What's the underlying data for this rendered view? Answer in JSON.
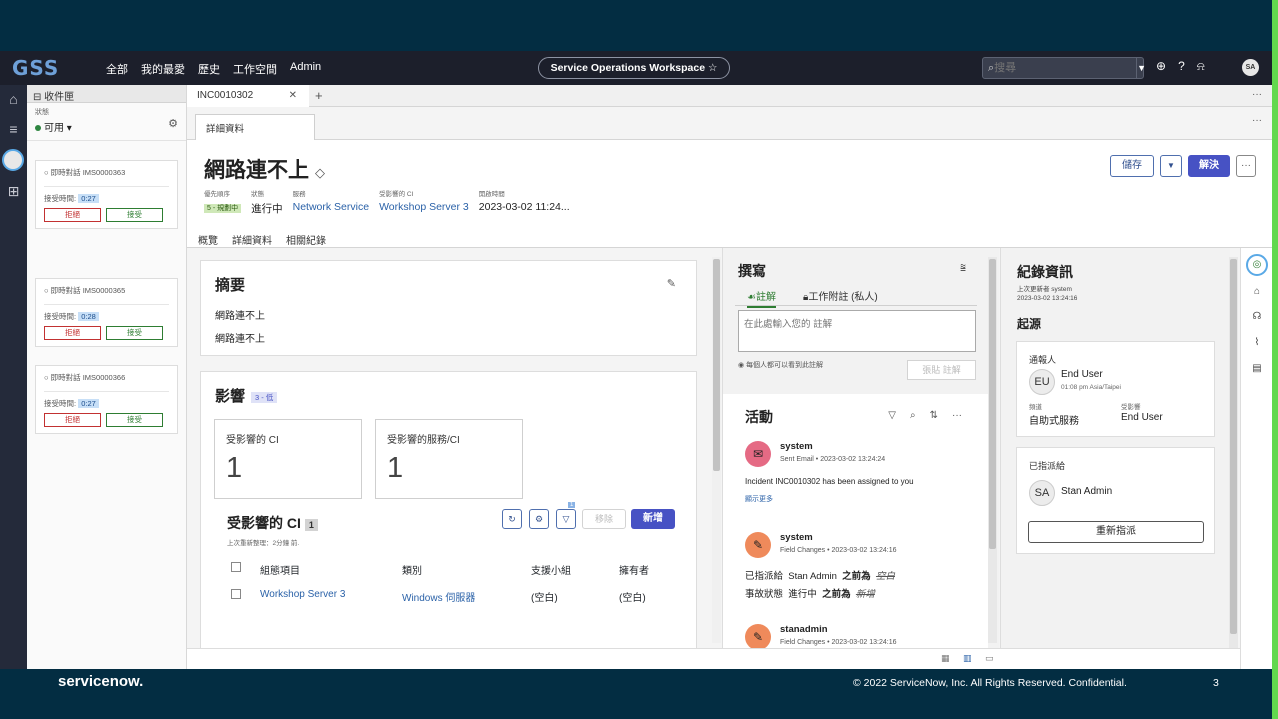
{
  "nav": {
    "logo": "GSS",
    "menu": [
      "全部",
      "我的最愛",
      "歷史",
      "工作空間",
      "Admin"
    ],
    "workspace": "Service Operations Workspace ☆",
    "search_placeholder": "搜尋",
    "avatar": "SA"
  },
  "inbox": {
    "title": "收件匣",
    "status_label": "狀態",
    "status_value": "可用 ▾",
    "cards": [
      {
        "id": "即時對話 IMS0000363",
        "time_label": "接受時間:",
        "time": "0:27",
        "decline": "拒絕",
        "accept": "接受"
      },
      {
        "id": "即時對話 IMS0000365",
        "time_label": "接受時間:",
        "time": "0:28",
        "decline": "拒絕",
        "accept": "接受"
      },
      {
        "id": "即時對話 IMS0000366",
        "time_label": "接受時間:",
        "time": "0:27",
        "decline": "拒絕",
        "accept": "接受"
      }
    ]
  },
  "tabs": {
    "record_tab": "INC0010302",
    "subtab": "詳細資料"
  },
  "record": {
    "title": "網路連不上",
    "buttons": {
      "save": "儲存",
      "resolve": "解決"
    },
    "meta": {
      "priority_label": "優先順序",
      "priority": "5 - 規劃中",
      "state_label": "狀態",
      "state": "進行中",
      "service_label": "服務",
      "service": "Network Service",
      "ci_label": "受影響的 CI",
      "ci": "Workshop Server 3",
      "opened_label": "開啟時間",
      "opened": "2023-03-02 11:24..."
    },
    "tabs": [
      "概覽",
      "詳細資料",
      "相關紀錄"
    ]
  },
  "summary": {
    "title": "摘要",
    "line1": "網路連不上",
    "line2": "網路連不上"
  },
  "impact": {
    "title": "影響",
    "badge": "3 - 低",
    "tile1_label": "受影響的 CI",
    "tile1_value": "1",
    "tile2_label": "受影響的服務/CI",
    "tile2_value": "1",
    "ci_title": "受影響的 CI",
    "ci_count": "1",
    "ci_sub": "上次重新整理：2分鐘 前.",
    "filter_badge": "1",
    "remove": "移除",
    "new": "新增",
    "columns": [
      "組態項目",
      "類別",
      "支援小組",
      "擁有者"
    ],
    "rows": [
      [
        "Workshop Server 3",
        "Windows 伺服器",
        "(空白)",
        "(空白)"
      ]
    ]
  },
  "compose": {
    "title": "撰寫",
    "tab1": "註解",
    "tab2": "工作附註 (私人)",
    "placeholder": "在此處輸入您的 註解",
    "visibility": "每個人都可以看到此註解",
    "post": "張貼 註解"
  },
  "activity": {
    "title": "活動",
    "entries": [
      {
        "name": "system",
        "meta": "Sent Email • 2023-03-02 13:24:24",
        "body": "Incident INC0010302 has been assigned to you",
        "more": "顯示更多"
      },
      {
        "name": "system",
        "meta": "Field Changes • 2023-03-02 13:24:16",
        "line1_a": "已指派給",
        "line1_b": "Stan Admin",
        "line1_c": "之前為",
        "line1_d": "空白",
        "line2_a": "事故狀態",
        "line2_b": "進行中",
        "line2_c": "之前為",
        "line2_d": "新增"
      },
      {
        "name": "stanadmin",
        "meta": "Field Changes • 2023-03-02 13:24:16"
      }
    ]
  },
  "info": {
    "title": "紀錄資訊",
    "updated_by": "上次更新者 system",
    "updated_at": "2023-03-02 13:24:16",
    "origin": "起源",
    "reporter_label": "通報人",
    "reporter_initials": "EU",
    "reporter_name": "End User",
    "reporter_time": "01:08 pm Asia/Taipei",
    "channel_label": "頻道",
    "channel_value": "自助式服務",
    "affected_label": "受影響",
    "affected_value": "End User",
    "assigned_label": "已指派給",
    "assigned_initials": "SA",
    "assigned_name": "Stan Admin",
    "reassign": "重新指派"
  },
  "footer": {
    "logo": "servicenow.",
    "copyright": "© 2022 ServiceNow, Inc. All Rights Reserved. Confidential.",
    "page": "3"
  },
  "colors": {
    "accent": "#4752c4",
    "nav_bg": "#1c1f2b",
    "slide_bg": "#032d42",
    "green": "#62d84e"
  }
}
